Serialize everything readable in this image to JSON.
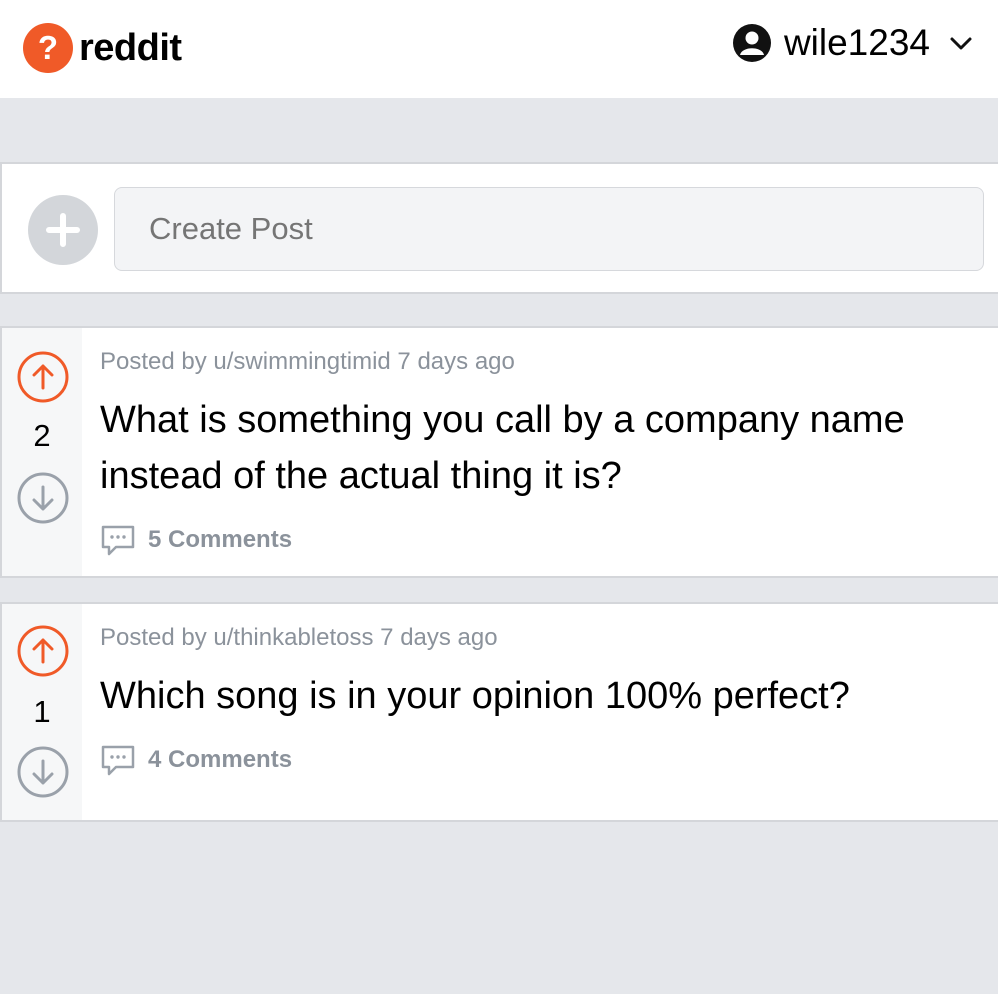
{
  "header": {
    "logo_symbol": "?",
    "logo_text": "reddit",
    "username": "wile1234",
    "user_icon": "user-circle-icon",
    "menu_icon": "chevron-down-icon"
  },
  "create_post": {
    "placeholder": "Create Post",
    "icon": "plus-icon"
  },
  "posts": [
    {
      "meta": "Posted by u/swimmingtimid 7 days ago",
      "title": "What is something you call by a company name instead of the actual thing it is?",
      "votes": "2",
      "comments": "5 Comments"
    },
    {
      "meta": "Posted by u/thinkabletoss 7 days ago",
      "title": "Which song is in your opinion 100% perfect?",
      "votes": "1",
      "comments": "4 Comments"
    }
  ],
  "colors": {
    "brand": "#f05a28",
    "muted": "#8b929b",
    "background": "#e5e7eb"
  }
}
